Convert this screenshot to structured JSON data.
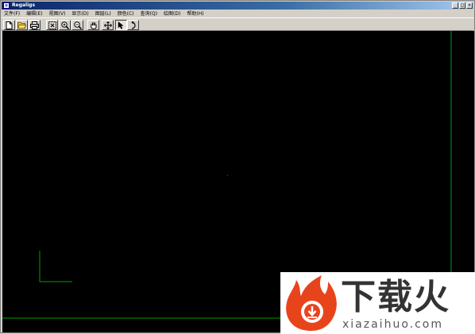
{
  "window": {
    "title": "Regaligs",
    "buttons": {
      "minimize": "_",
      "maximize": "□",
      "close": "×"
    }
  },
  "menubar": {
    "items": [
      {
        "label": "文件(F)"
      },
      {
        "label": "编辑(E)"
      },
      {
        "label": "视图(V)"
      },
      {
        "label": "显示(D)"
      },
      {
        "label": "图层(L)"
      },
      {
        "label": "颜色(C)"
      },
      {
        "label": "查询(Q)"
      },
      {
        "label": "绘图(D)"
      },
      {
        "label": "帮助(H)"
      }
    ]
  },
  "toolbar": {
    "tools": [
      {
        "icon": "new-file-icon"
      },
      {
        "icon": "open-folder-icon"
      },
      {
        "icon": "print-icon"
      },
      {
        "icon": "zoom-extents-icon"
      },
      {
        "icon": "zoom-in-icon"
      },
      {
        "icon": "zoom-out-icon"
      },
      {
        "icon": "pan-hand-icon"
      },
      {
        "icon": "move-icon"
      },
      {
        "icon": "select-arrow-icon",
        "pressed": true
      },
      {
        "icon": "rotate-icon"
      }
    ]
  },
  "canvas": {
    "background": "#000000",
    "line_color": "#00a000"
  },
  "watermark": {
    "brand": "下载火",
    "domain": "xiazaihuo.com",
    "accent": "#e8441c"
  }
}
